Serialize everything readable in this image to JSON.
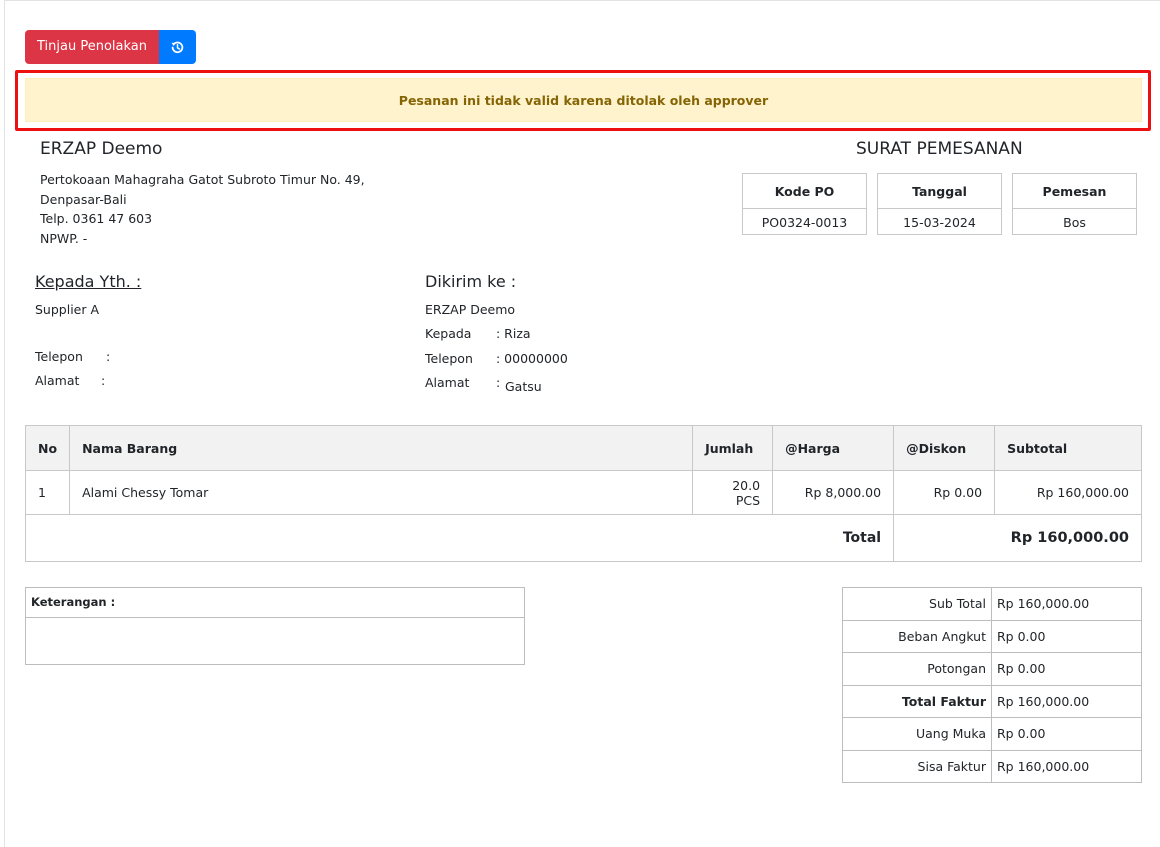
{
  "toolbar": {
    "reject_review_label": "Tinjau Penolakan",
    "history_icon": "history-icon"
  },
  "alert": {
    "message": "Pesanan ini tidak valid karena ditolak oleh approver"
  },
  "company": {
    "name": "ERZAP Deemo",
    "address_line1": "Pertokoaan Mahagraha Gatot Subroto Timur No. 49,",
    "address_line2": "Denpasar-Bali",
    "phone": "Telp. 0361 47 603",
    "npwp": "NPWP. -"
  },
  "document": {
    "title": "SURAT PEMESANAN",
    "meta": [
      {
        "label": "Kode PO",
        "value": "PO0324-0013"
      },
      {
        "label": "Tanggal",
        "value": "15-03-2024"
      },
      {
        "label": "Pemesan",
        "value": "Bos"
      }
    ]
  },
  "recipient": {
    "heading": "Kepada Yth. :",
    "name": "Supplier A",
    "phone_label": "Telepon",
    "address_label": "Alamat",
    "colon": ":"
  },
  "shipping": {
    "heading": "Dikirim ke :",
    "name": "ERZAP Deemo",
    "attn_label": "Kepada",
    "attn_value": ": Riza",
    "phone_label": "Telepon",
    "phone_value": ": 00000000",
    "address_label": "Alamat",
    "address_colon": ":",
    "address_value": "Gatsu"
  },
  "items_table": {
    "headers": [
      "No",
      "Nama Barang",
      "Jumlah",
      "@Harga",
      "@Diskon",
      "Subtotal"
    ],
    "rows": [
      {
        "no": "1",
        "name": "Alami Chessy Tomar",
        "qty": "20.0 PCS",
        "price": "Rp 8,000.00",
        "discount": "Rp 0.00",
        "subtotal": "Rp 160,000.00"
      }
    ],
    "total_label": "Total",
    "total_value": "Rp 160,000.00"
  },
  "notes": {
    "label": "Keterangan :"
  },
  "summary": [
    {
      "label": "Sub Total",
      "value": "Rp 160,000.00"
    },
    {
      "label": "Beban Angkut",
      "value": "Rp 0.00"
    },
    {
      "label": "Potongan",
      "value": "Rp 0.00"
    },
    {
      "label": "Total Faktur",
      "value": "Rp 160,000.00"
    },
    {
      "label": "Uang Muka",
      "value": "Rp 0.00"
    },
    {
      "label": "Sisa Faktur",
      "value": "Rp 160,000.00"
    }
  ],
  "colors": {
    "danger": "#dc3545",
    "primary": "#007bff",
    "warning_bg": "#fff3cd",
    "warning_text": "#856404",
    "highlight": "#ee1010"
  }
}
